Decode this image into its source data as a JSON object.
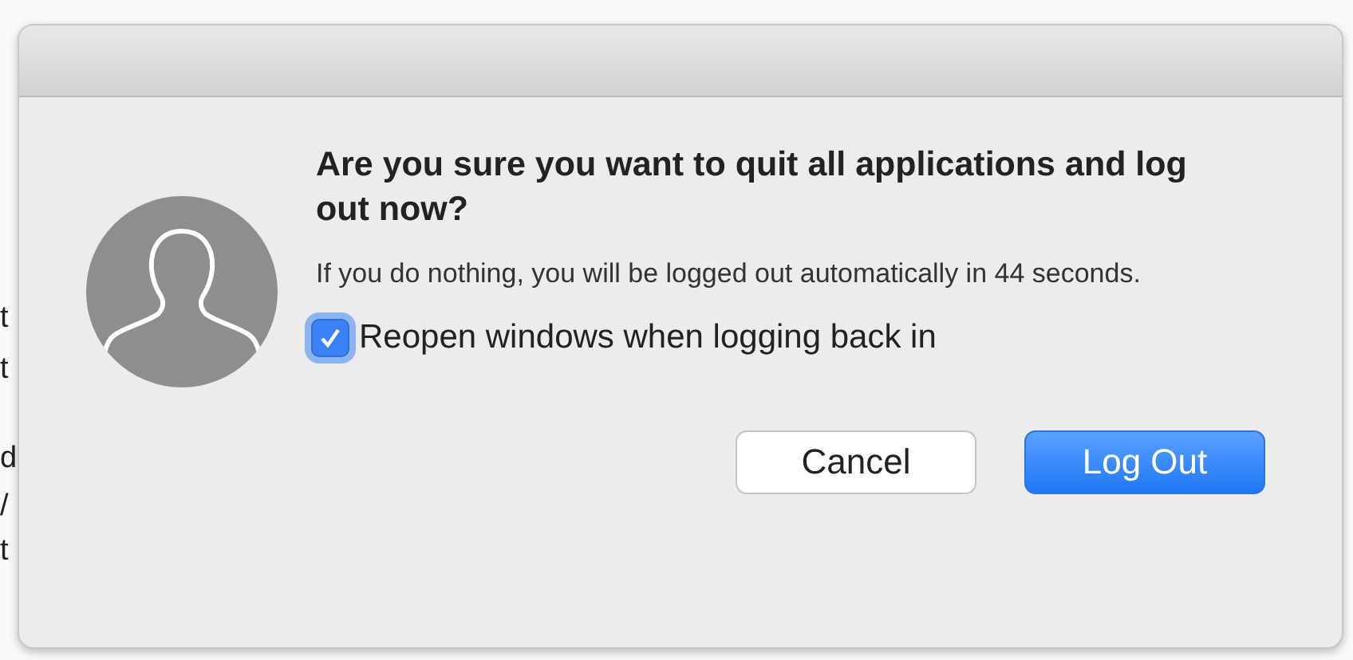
{
  "background_text": [
    "t",
    "t",
    "d",
    "/",
    "t"
  ],
  "dialog": {
    "heading": "Are you sure you want to quit all applications and log out now?",
    "message": "If you do nothing, you will be logged out automatically in 44 seconds.",
    "checkbox": {
      "label": "Reopen windows when logging back in",
      "checked": true
    },
    "buttons": [
      {
        "label": "Cancel",
        "kind": "secondary"
      },
      {
        "label": "Log Out",
        "kind": "primary"
      }
    ]
  }
}
